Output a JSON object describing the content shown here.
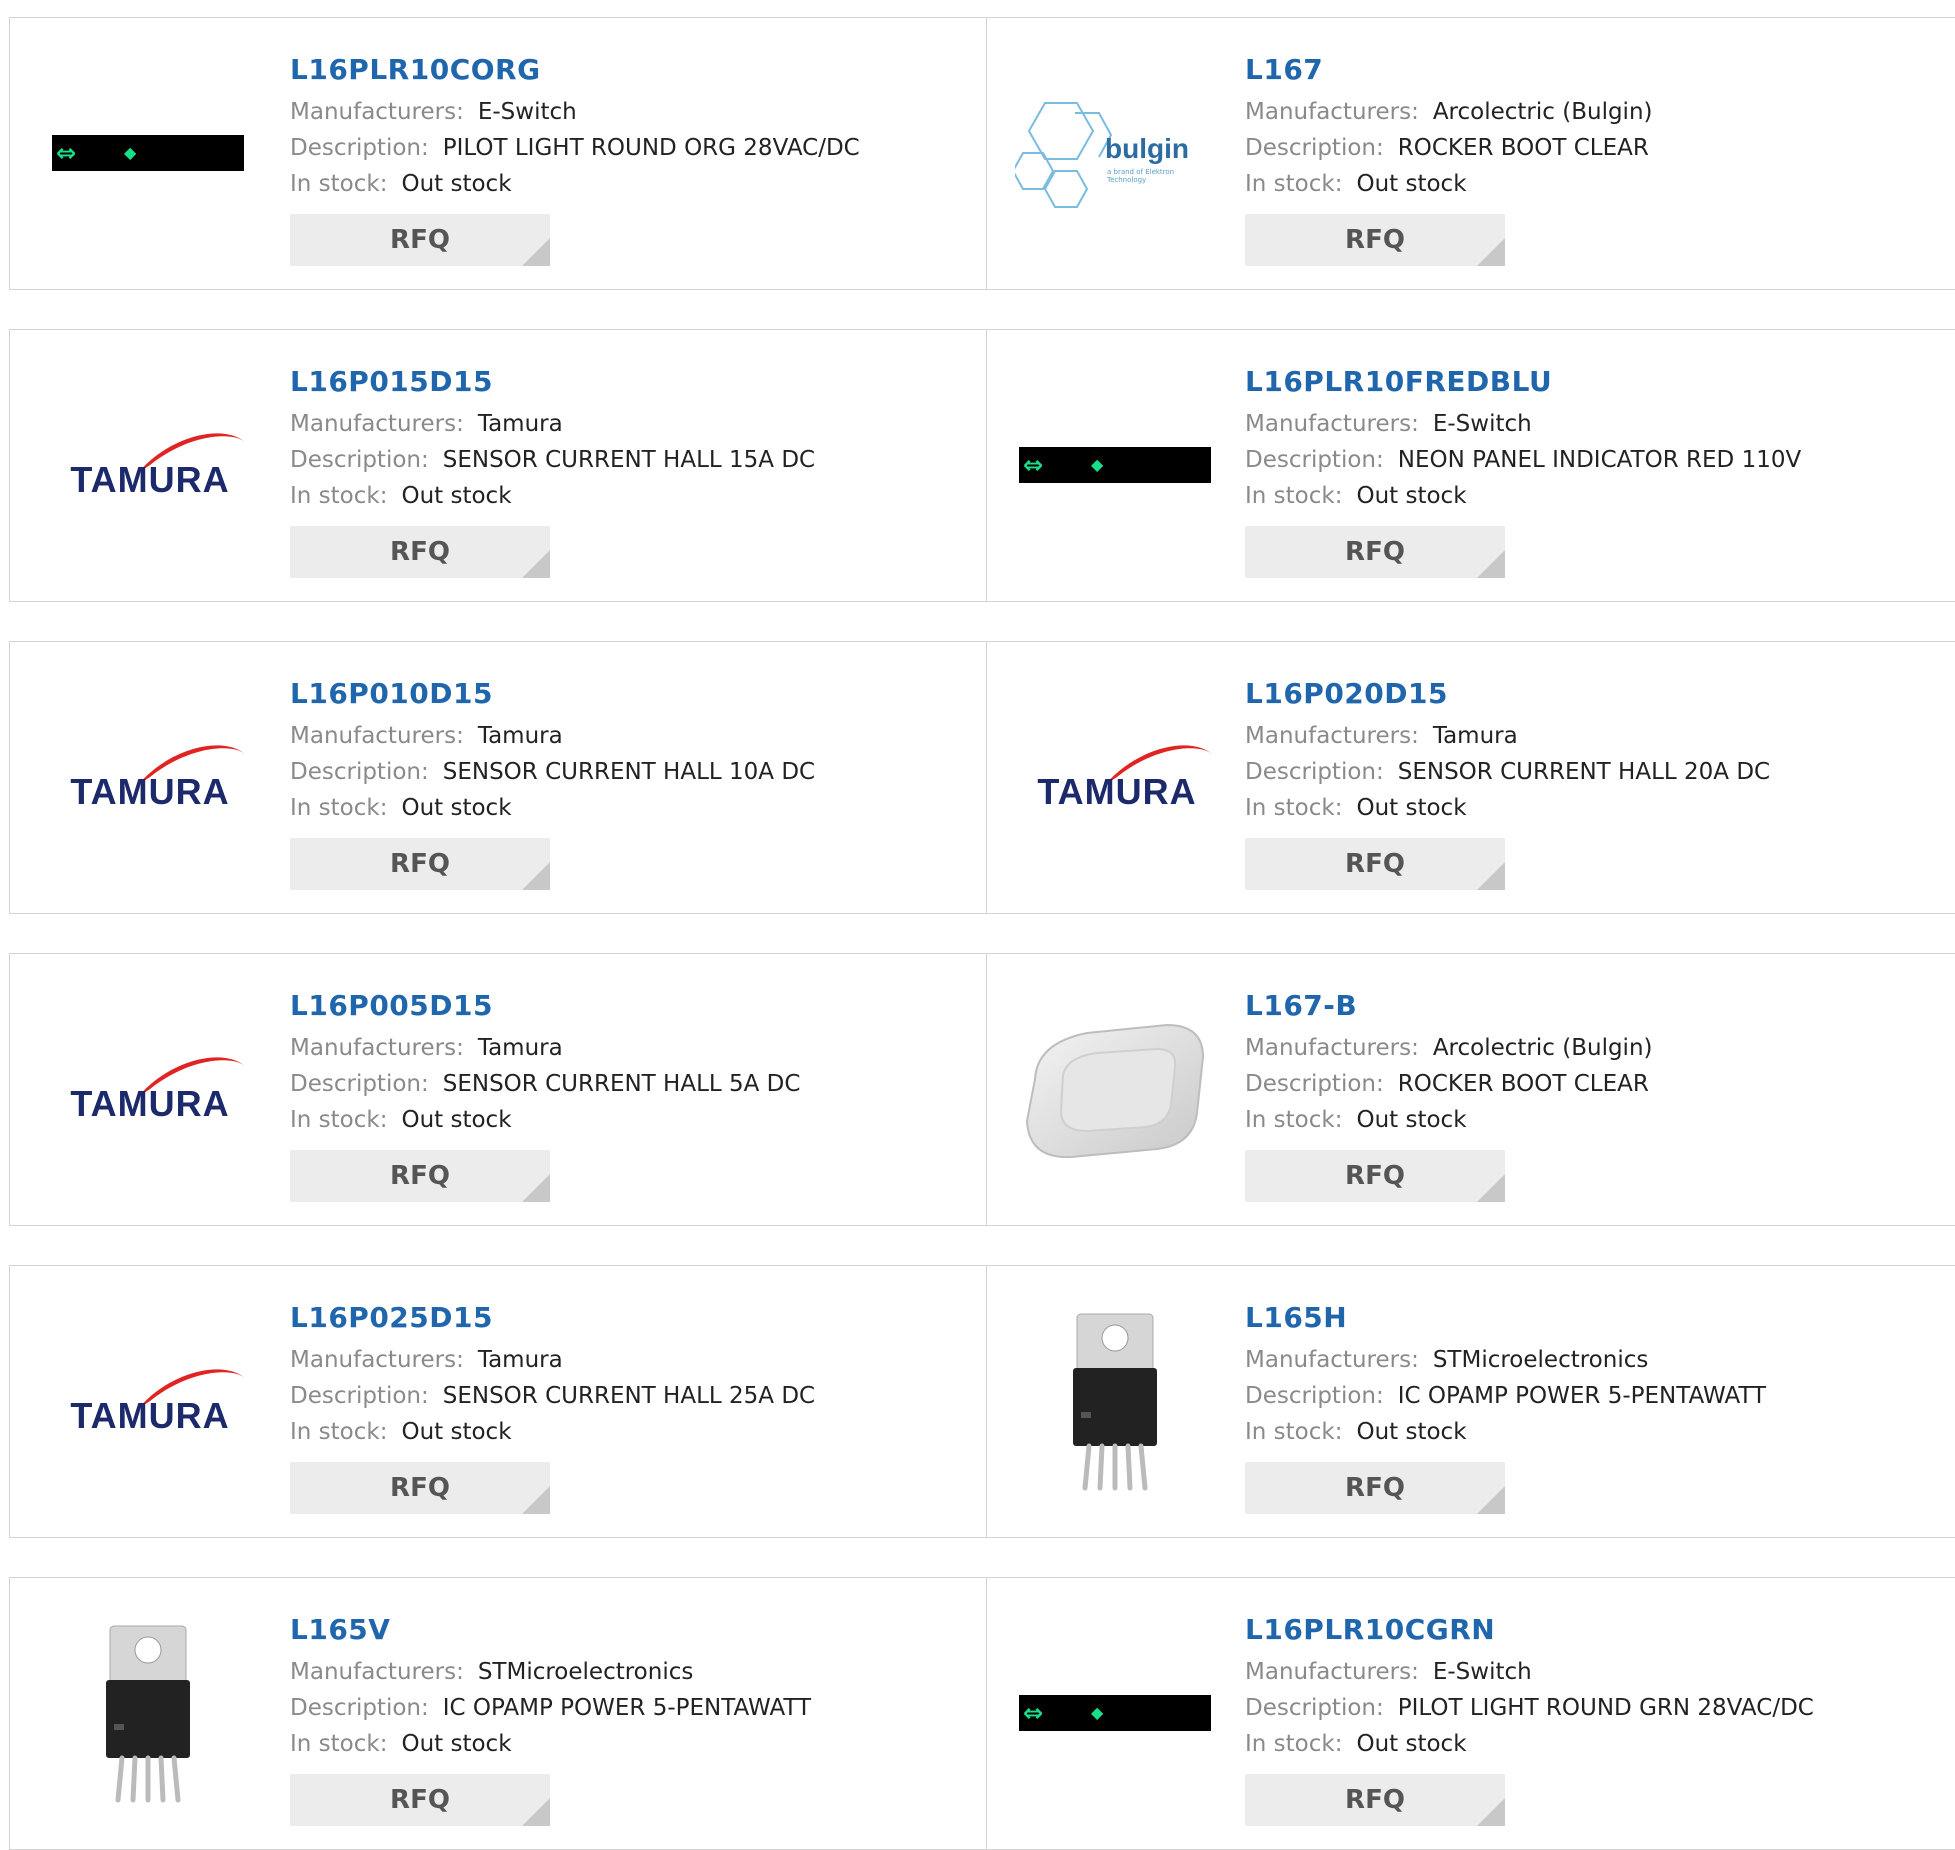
{
  "labels": {
    "manufacturer": "Manufacturers:",
    "description": "Description:",
    "stock": "In stock:",
    "rfq": "RFQ"
  },
  "products": [
    {
      "part": "L16PLR10CORG",
      "manufacturer": "E-Switch",
      "description": "PILOT LIGHT ROUND ORG 28VAC/DC",
      "stock": "Out stock",
      "image": "eswitch"
    },
    {
      "part": "L167",
      "manufacturer": "Arcolectric (Bulgin)",
      "description": "ROCKER BOOT CLEAR",
      "stock": "Out stock",
      "image": "bulgin"
    },
    {
      "part": "L16P015D15",
      "manufacturer": "Tamura",
      "description": "SENSOR CURRENT HALL 15A DC",
      "stock": "Out stock",
      "image": "tamura"
    },
    {
      "part": "L16PLR10FREDBLU",
      "manufacturer": "E-Switch",
      "description": "NEON PANEL INDICATOR RED 110V",
      "stock": "Out stock",
      "image": "eswitch"
    },
    {
      "part": "L16P010D15",
      "manufacturer": "Tamura",
      "description": "SENSOR CURRENT HALL 10A DC",
      "stock": "Out stock",
      "image": "tamura"
    },
    {
      "part": "L16P020D15",
      "manufacturer": "Tamura",
      "description": "SENSOR CURRENT HALL 20A DC",
      "stock": "Out stock",
      "image": "tamura"
    },
    {
      "part": "L16P005D15",
      "manufacturer": "Tamura",
      "description": "SENSOR CURRENT HALL 5A DC",
      "stock": "Out stock",
      "image": "tamura"
    },
    {
      "part": "L167-B",
      "manufacturer": "Arcolectric (Bulgin)",
      "description": "ROCKER BOOT CLEAR",
      "stock": "Out stock",
      "image": "rocker-boot"
    },
    {
      "part": "L16P025D15",
      "manufacturer": "Tamura",
      "description": "SENSOR CURRENT HALL 25A DC",
      "stock": "Out stock",
      "image": "tamura"
    },
    {
      "part": "L165H",
      "manufacturer": "STMicroelectronics",
      "description": "IC OPAMP POWER 5-PENTAWATT",
      "stock": "Out stock",
      "image": "pentawatt-h"
    },
    {
      "part": "L165V",
      "manufacturer": "STMicroelectronics",
      "description": "IC OPAMP POWER 5-PENTAWATT",
      "stock": "Out stock",
      "image": "pentawatt-v"
    },
    {
      "part": "L16PLR10CGRN",
      "manufacturer": "E-Switch",
      "description": "PILOT LIGHT ROUND GRN 28VAC/DC",
      "stock": "Out stock",
      "image": "eswitch"
    }
  ],
  "brand_logos": {
    "tamura": "TAMURA",
    "bulgin": "bulgin",
    "bulgin_tag": "a brand of Elektron Technology"
  },
  "colors": {
    "link": "#1f66ad",
    "label": "#8a8a8a",
    "button_bg": "#ececec",
    "border": "#d4d4d4"
  }
}
